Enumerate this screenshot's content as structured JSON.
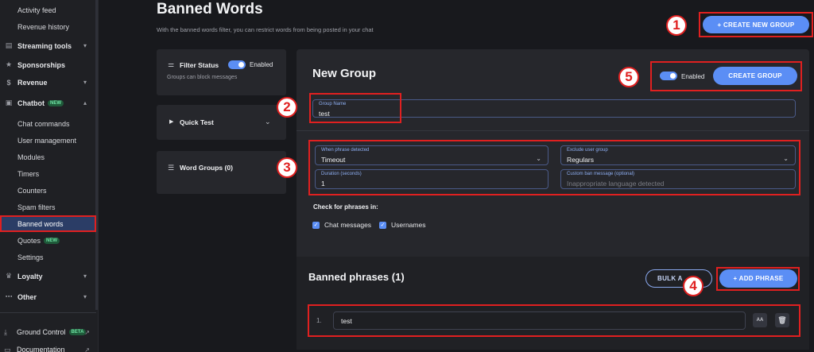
{
  "sidebar": {
    "items": [
      {
        "label": "Activity feed"
      },
      {
        "label": "Revenue history"
      },
      {
        "label": "Streaming tools",
        "chevron": "▾"
      },
      {
        "label": "Sponsorships"
      },
      {
        "label": "Revenue",
        "chevron": "▾"
      },
      {
        "label": "Chatbot",
        "badge": "NEW",
        "chevron": "▴"
      },
      {
        "label": "Chat commands"
      },
      {
        "label": "User management"
      },
      {
        "label": "Modules"
      },
      {
        "label": "Timers"
      },
      {
        "label": "Counters"
      },
      {
        "label": "Spam filters"
      },
      {
        "label": "Banned words"
      },
      {
        "label": "Quotes",
        "badge": "NEW"
      },
      {
        "label": "Settings"
      },
      {
        "label": "Loyalty",
        "chevron": "▾"
      },
      {
        "label": "Other",
        "chevron": "▾"
      }
    ],
    "bottom": [
      {
        "label": "Ground Control",
        "badge": "BETA"
      },
      {
        "label": "Documentation"
      }
    ]
  },
  "header": {
    "title": "Banned Words",
    "description": "With the banned words filter, you can restrict words from being posted in your chat",
    "create_new_group_label": "+ CREATE NEW GROUP"
  },
  "filter_status": {
    "title": "Filter Status",
    "toggle_label": "Enabled",
    "subtitle": "Groups can block messages"
  },
  "quick_test": {
    "title": "Quick Test"
  },
  "word_groups": {
    "title": "Word Groups (0)"
  },
  "group_form": {
    "title": "New Group",
    "enabled_label": "Enabled",
    "create_group_label": "CREATE GROUP",
    "group_name": {
      "label": "Group Name",
      "value": "test"
    },
    "when_phrase_detected": {
      "label": "When phrase detected",
      "value": "Timeout"
    },
    "exclude_user_group": {
      "label": "Exclude user group",
      "value": "Regulars"
    },
    "duration": {
      "label": "Duration (seconds)",
      "value": "1"
    },
    "custom_ban_message": {
      "label": "Custom ban message (optional)",
      "placeholder": "Inappropriate language detected"
    },
    "check_for_phrases_label": "Check for phrases in:",
    "chat_messages_label": "Chat messages",
    "usernames_label": "Usernames"
  },
  "banned_phrases": {
    "title": "Banned phrases (1)",
    "bulk_label": "BULK A",
    "add_phrase_label": "+ ADD PHRASE",
    "rows": [
      {
        "number": "1.",
        "value": "test",
        "case_label": "AA"
      }
    ]
  },
  "callouts": [
    "1",
    "2",
    "3",
    "4",
    "5"
  ],
  "colors": {
    "accent": "#5b8ef5",
    "annotation": "#e02020",
    "background": "#18191d",
    "panel": "#26272c"
  }
}
